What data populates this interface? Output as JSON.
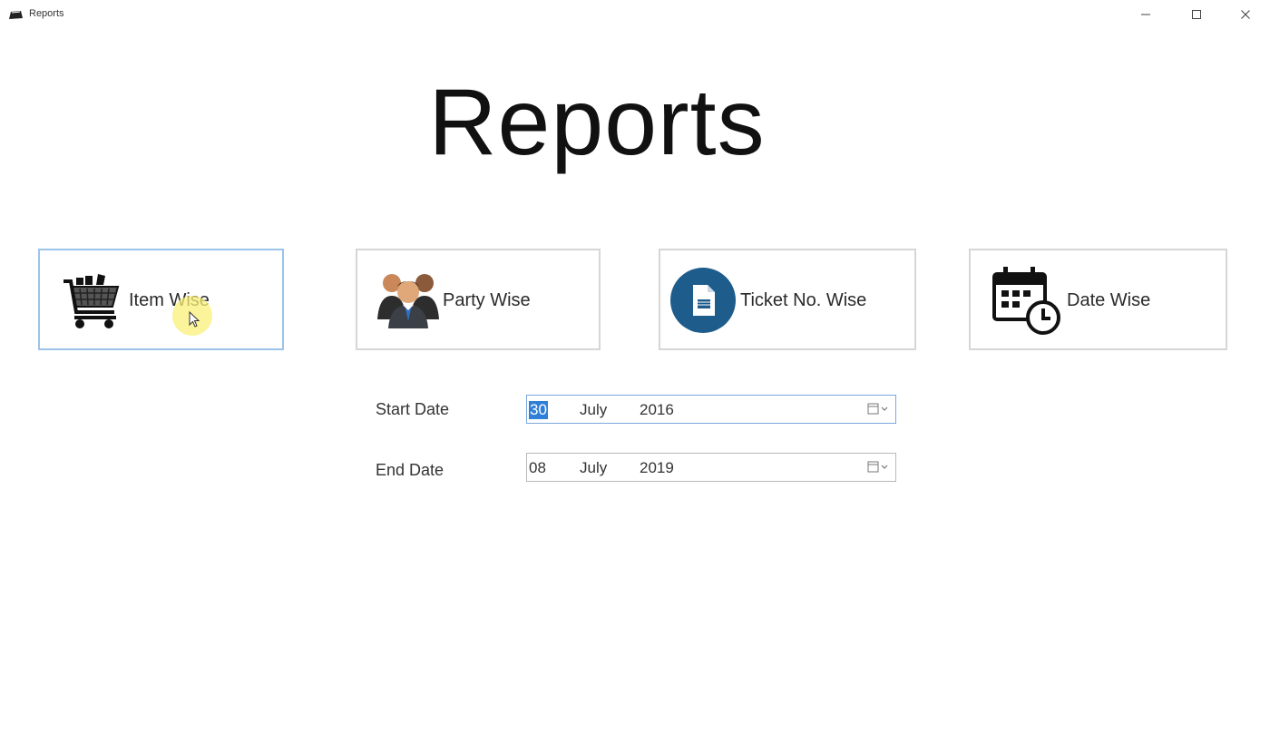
{
  "window": {
    "title": "Reports",
    "controls": {
      "minimize": "minimize-icon",
      "maximize": "maximize-icon",
      "close": "close-icon"
    }
  },
  "page": {
    "heading": "Reports"
  },
  "report_buttons": [
    {
      "label": "Item Wise",
      "icon": "shopping-cart-icon",
      "active": true
    },
    {
      "label": "Party Wise",
      "icon": "people-group-icon",
      "active": false
    },
    {
      "label": "Ticket No. Wise",
      "icon": "document-circle-icon",
      "active": false
    },
    {
      "label": "Date Wise",
      "icon": "calendar-clock-icon",
      "active": false
    }
  ],
  "date_range": {
    "start": {
      "label": "Start Date",
      "day": "30",
      "month": "July",
      "year": "2016"
    },
    "end": {
      "label": "End Date",
      "day": "08",
      "month": "July",
      "year": "2019"
    }
  },
  "colors": {
    "active_border": "#9cc3ea",
    "ticket_icon_bg": "#1e5c8c",
    "selection": "#2f7fd8"
  }
}
